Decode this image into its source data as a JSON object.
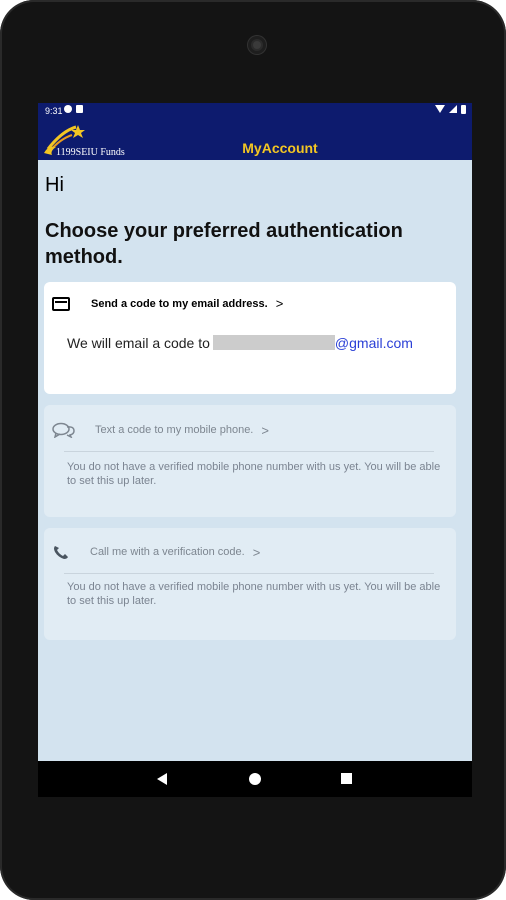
{
  "status_bar": {
    "time": "9:31",
    "left_icons": [
      "data-saver-icon",
      "sim-icon"
    ],
    "right_icons": [
      "wifi-icon",
      "signal-icon",
      "battery-icon"
    ]
  },
  "app_bar": {
    "logo_text": "1199SEIU Funds",
    "title": "MyAccount",
    "title_color": "#f3c623",
    "background": "#0d1b6e"
  },
  "main": {
    "greeting": "Hi",
    "heading": "Choose your preferred authentication method.",
    "options": [
      {
        "icon": "email-icon",
        "label": "Send a code to my email address.",
        "chevron": ">",
        "email_prefix": "We will email a code to",
        "email_domain": "@gmail.com",
        "enabled": true
      },
      {
        "icon": "chat-icon",
        "label": "Text a code to my mobile phone.",
        "chevron": ">",
        "description": "You do not have a verified mobile phone number with us yet. You will be able to set this up later.",
        "enabled": false
      },
      {
        "icon": "phone-icon",
        "label": "Call me with a verification code.",
        "chevron": ">",
        "description": "You do not have a verified mobile phone number with us yet. You will be able to set this up later.",
        "enabled": false
      }
    ]
  },
  "nav_bar": {
    "buttons": [
      "back-icon",
      "home-icon",
      "recents-icon"
    ]
  }
}
